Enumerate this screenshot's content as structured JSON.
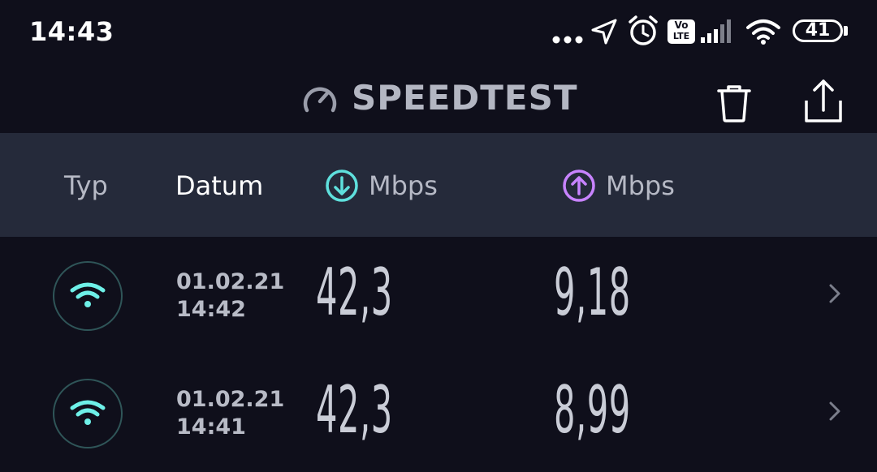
{
  "status_bar": {
    "time": "14:43",
    "battery_level": "41",
    "volte_top": "Vo",
    "volte_bottom": "LTE",
    "icons": [
      "more-dots-icon",
      "location-arrow-icon",
      "alarm-clock-icon",
      "volte-icon",
      "cell-signal-icon",
      "wifi-icon",
      "battery-icon"
    ]
  },
  "header": {
    "title": "SPEEDTEST",
    "logo_icon": "speedometer-icon",
    "actions": [
      {
        "name": "delete",
        "icon": "trash-icon"
      },
      {
        "name": "share",
        "icon": "share-icon"
      }
    ]
  },
  "columns": {
    "type": "Typ",
    "date": "Datum",
    "download": "Mbps",
    "upload": "Mbps",
    "download_icon": "download-arrow-icon",
    "upload_icon": "upload-arrow-icon"
  },
  "results": [
    {
      "connection": "wifi",
      "date": "01.02.21",
      "time": "14:42",
      "download": "42,3",
      "upload": "9,18"
    },
    {
      "connection": "wifi",
      "date": "01.02.21",
      "time": "14:41",
      "download": "42,3",
      "upload": "8,99"
    }
  ],
  "colors": {
    "background": "#0f0f1b",
    "header_band": "#252a3a",
    "download_accent": "#5fe0dd",
    "upload_accent": "#c883ff",
    "wifi_accent": "#6ef0e8"
  }
}
